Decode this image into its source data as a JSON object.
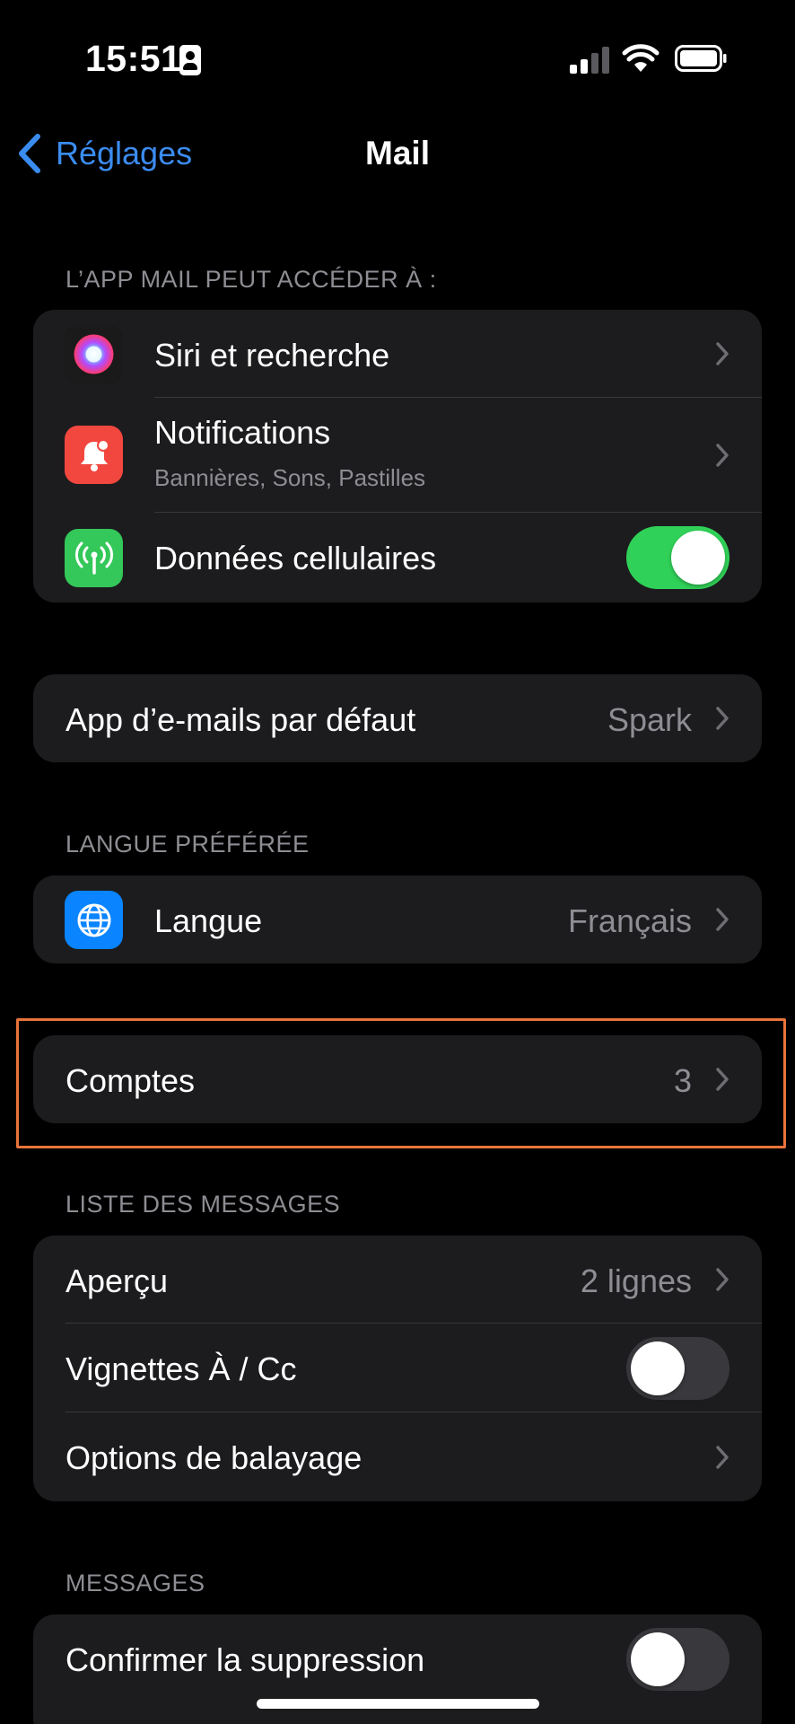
{
  "status_bar": {
    "time": "15:51"
  },
  "nav": {
    "back_label": "Réglages",
    "title": "Mail"
  },
  "sections": {
    "access_header": "L’APP MAIL PEUT ACCÉDER À :",
    "language_header": "LANGUE PRÉFÉRÉE",
    "message_list_header": "LISTE DES MESSAGES",
    "messages_header": "MESSAGES"
  },
  "access": {
    "siri": {
      "label": "Siri et recherche"
    },
    "notifications": {
      "label": "Notifications",
      "subtitle": "Bannières, Sons, Pastilles"
    },
    "cellular": {
      "label": "Données cellulaires",
      "enabled": true
    }
  },
  "default_app": {
    "label": "App d’e-mails par défaut",
    "value": "Spark"
  },
  "language": {
    "label": "Langue",
    "value": "Français"
  },
  "accounts": {
    "label": "Comptes",
    "value": "3"
  },
  "message_list": {
    "preview": {
      "label": "Aperçu",
      "value": "2 lignes"
    },
    "to_cc": {
      "label": "Vignettes À / Cc",
      "enabled": false
    },
    "swipe": {
      "label": "Options de balayage"
    }
  },
  "messages": {
    "confirm_delete": {
      "label": "Confirmer la suppression",
      "enabled": false
    }
  },
  "colors": {
    "accent": "#3b8cf0",
    "toggle_on": "#30d158",
    "notifications_icon": "#f2473f",
    "cellular_icon": "#34c759",
    "language_icon": "#0a84ff",
    "highlight": "#e8743b"
  },
  "icons": {
    "siri": "siri-orb-icon",
    "notifications": "bell-icon",
    "cellular": "antenna-icon",
    "language": "globe-icon"
  }
}
